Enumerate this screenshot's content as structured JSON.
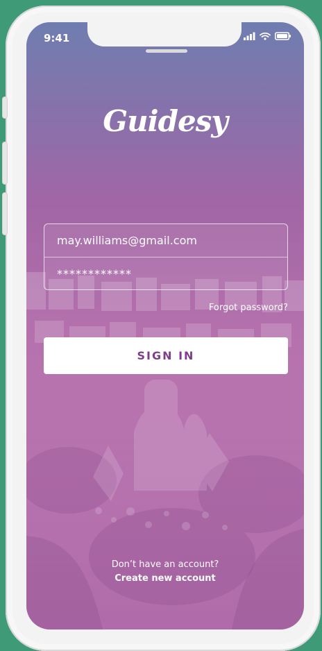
{
  "status_bar": {
    "time": "9:41"
  },
  "app": {
    "logo_text": "Guidesy"
  },
  "form": {
    "email_value": "may.williams@gmail.com",
    "password_value": "************"
  },
  "links": {
    "forgot_password": "Forgot password?",
    "no_account": "Don’t have an account?",
    "create_account": "Create new account"
  },
  "button": {
    "sign_in": "SIGN IN"
  },
  "icons": {
    "signal": "signal-icon",
    "wifi": "wifi-icon",
    "battery": "battery-icon"
  },
  "colors": {
    "background": "#3f9a78",
    "screen_top": "#5f6fa7",
    "screen_mid": "#9b5a9f",
    "screen_bottom": "#b779b1",
    "button_text": "#7d3f8b"
  }
}
